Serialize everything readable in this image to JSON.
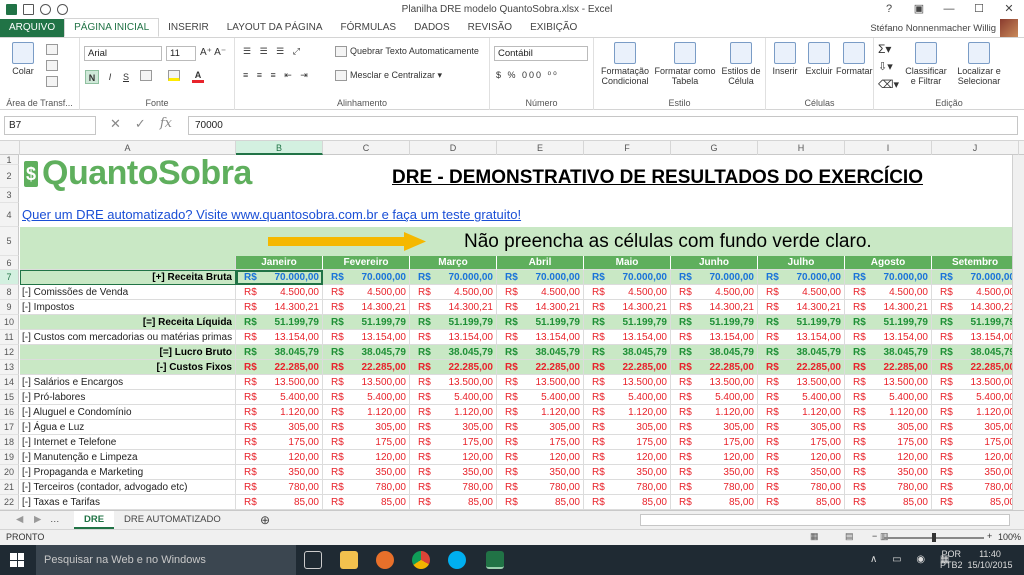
{
  "window": {
    "title": "Planilha DRE modelo QuantoSobra.xlsx - Excel",
    "help": "?",
    "min": "—",
    "max": "☐",
    "close": "✕"
  },
  "tabs": [
    "ARQUIVO",
    "PÁGINA INICIAL",
    "INSERIR",
    "LAYOUT DA PÁGINA",
    "FÓRMULAS",
    "DADOS",
    "REVISÃO",
    "EXIBIÇÃO"
  ],
  "user": "Stéfano Nonnenmacher Willig",
  "ribbon": {
    "clipboard": {
      "paste": "Colar",
      "label": "Área de Transf..."
    },
    "font": {
      "name": "Arial",
      "size": "11",
      "bold": "N",
      "italic": "I",
      "underline": "S",
      "label": "Fonte"
    },
    "alignment": {
      "wrap": "Quebrar Texto Automaticamente",
      "merge": "Mesclar e Centralizar",
      "label": "Alinhamento"
    },
    "number": {
      "format": "Contábil",
      "label": "Número"
    },
    "styles": {
      "cond": "Formatação Condicional",
      "table": "Formatar como Tabela",
      "cell": "Estilos de Célula",
      "label": "Estilo"
    },
    "cells": {
      "insert": "Inserir",
      "delete": "Excluir",
      "format": "Formatar",
      "label": "Células"
    },
    "editing": {
      "sort": "Classificar e Filtrar",
      "find": "Localizar e Selecionar",
      "label": "Edição"
    }
  },
  "formula": {
    "namebox": "B7",
    "value": "70000"
  },
  "columns": [
    "A",
    "B",
    "C",
    "D",
    "E",
    "F",
    "G",
    "H",
    "I",
    "J"
  ],
  "sheet": {
    "logo": "QuantoSobra",
    "heading": "DRE - DEMONSTRATIVO DE RESULTADOS DO EXERCÍCIO",
    "link": "Quer um DRE automatizado? Visite www.quantosobra.com.br e faça um teste gratuito!",
    "notice": "Não preencha as células com fundo verde claro.",
    "currency": "R$",
    "months": [
      "Janeiro",
      "Fevereiro",
      "Março",
      "Abril",
      "Maio",
      "Junho",
      "Julho",
      "Agosto",
      "Setembro"
    ],
    "rows": [
      {
        "n": "7",
        "label": "[+] Receita Bruta",
        "value": "70.000,00",
        "style": "blue",
        "head": true
      },
      {
        "n": "8",
        "label": "[-] Comissões de Venda",
        "value": "4.500,00",
        "style": "red"
      },
      {
        "n": "9",
        "label": "[-] Impostos",
        "value": "14.300,21",
        "style": "red"
      },
      {
        "n": "10",
        "label": "[=] Receita Líquida",
        "value": "51.199,79",
        "style": "green",
        "head": true
      },
      {
        "n": "11",
        "label": "[-] Custos com mercadorias ou matérias primas",
        "value": "13.154,00",
        "style": "red"
      },
      {
        "n": "12",
        "label": "[=] Lucro Bruto",
        "value": "38.045,79",
        "style": "green",
        "head": true
      },
      {
        "n": "13",
        "label": "[-] Custos Fixos",
        "value": "22.285,00",
        "style": "redb",
        "head": true
      },
      {
        "n": "14",
        "label": "[-] Salários e Encargos",
        "value": "13.500,00",
        "style": "red"
      },
      {
        "n": "15",
        "label": "[-] Pró-labores",
        "value": "5.400,00",
        "style": "red"
      },
      {
        "n": "16",
        "label": "[-] Aluguel e Condomínio",
        "value": "1.120,00",
        "style": "red"
      },
      {
        "n": "17",
        "label": "[-] Água e Luz",
        "value": "305,00",
        "style": "red"
      },
      {
        "n": "18",
        "label": "[-] Internet e Telefone",
        "value": "175,00",
        "style": "red"
      },
      {
        "n": "19",
        "label": "[-] Manutenção e Limpeza",
        "value": "120,00",
        "style": "red"
      },
      {
        "n": "20",
        "label": "[-] Propaganda e Marketing",
        "value": "350,00",
        "style": "red"
      },
      {
        "n": "21",
        "label": "[-] Terceiros (contador, advogado etc)",
        "value": "780,00",
        "style": "red"
      },
      {
        "n": "22",
        "label": "[-] Taxas e Tarifas",
        "value": "85,00",
        "style": "red"
      }
    ]
  },
  "sheettabs": [
    "DRE",
    "DRE AUTOMATIZADO"
  ],
  "status": {
    "left": "PRONTO",
    "zoom": "100%"
  },
  "taskbar": {
    "search": "Pesquisar na Web e no Windows",
    "lang": "POR",
    "layout": "PTB2",
    "time": "11:40",
    "date": "15/10/2015"
  }
}
